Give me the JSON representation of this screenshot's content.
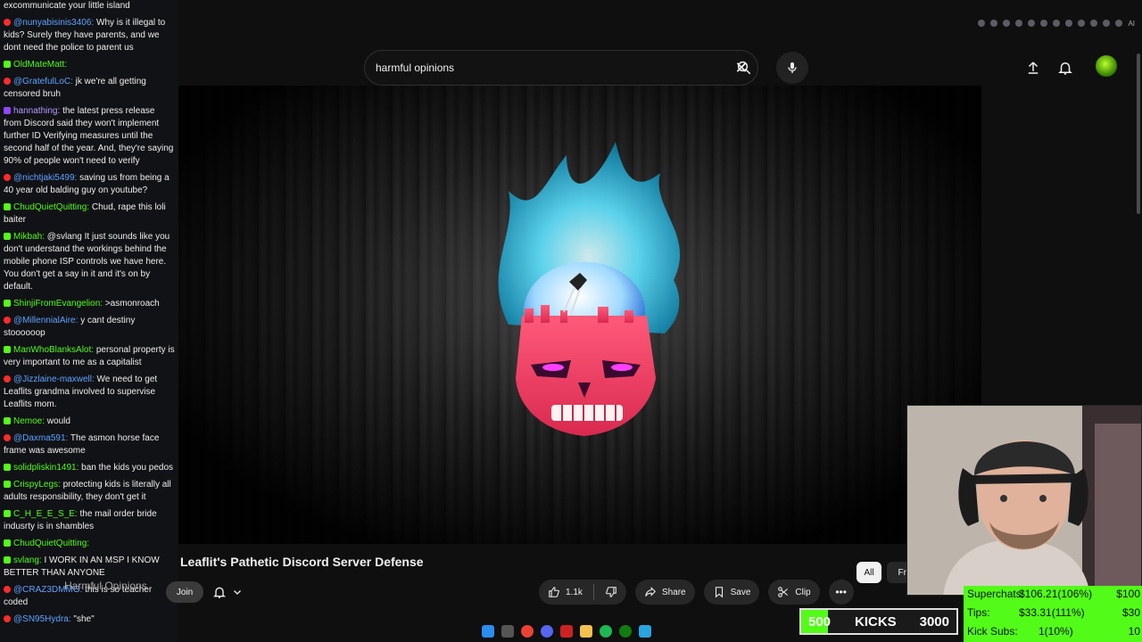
{
  "chat": {
    "messages": [
      {
        "platform": "none",
        "user": "",
        "text": "excommunicate your little island"
      },
      {
        "platform": "yt",
        "user": "@nunyabisinis3406:",
        "text": "Why is it illegal to kids? Surely they have parents, and we dont need the police to parent us"
      },
      {
        "platform": "kick",
        "user": "OldMateMatt:",
        "text": ""
      },
      {
        "platform": "yt",
        "user": "@GratefulLoC:",
        "text": "jk we're all getting censored bruh"
      },
      {
        "platform": "tw",
        "user": "hannathing:",
        "text": "the latest press release from Discord said they won't implement further ID Verifying measures until the second half of the year. And, they're saying 90% of people won't need to verify"
      },
      {
        "platform": "yt",
        "user": "@nichtjaki5499:",
        "text": "saving us from being a 40 year old balding guy on youtube?"
      },
      {
        "platform": "kick",
        "user": "ChudQuietQuitting:",
        "text": "Chud, rape this loli baiter"
      },
      {
        "platform": "kick",
        "user": "Mikbah:",
        "text": "@svlang It just sounds like you don't understand the workings behind the mobile phone ISP controls we have here. You don't get a say in it and it's on by default."
      },
      {
        "platform": "kick",
        "user": "ShinjiFromEvangelion:",
        "text": ">asmonroach"
      },
      {
        "platform": "yt",
        "user": "@MillennialAire:",
        "text": "y cant destiny stoooooop"
      },
      {
        "platform": "kick",
        "user": "ManWhoBlanksAlot:",
        "text": "personal property is very important to me as a capitalist"
      },
      {
        "platform": "yt",
        "user": "@Jizzlaine-maxwell:",
        "text": "We need to get Leaflits grandma involved to supervise Leaflits mom."
      },
      {
        "platform": "kick",
        "user": "Nemoe:",
        "text": "would"
      },
      {
        "platform": "yt",
        "user": "@Daxma591:",
        "text": "The asmon horse face frame was awesome"
      },
      {
        "platform": "kick",
        "user": "solidpliskin1491:",
        "text": "ban the kids you pedos"
      },
      {
        "platform": "kick",
        "user": "CrispyLegs:",
        "text": "protecting kids is literally all adults responsibility, they don't get it"
      },
      {
        "platform": "kick",
        "user": "C_H_E_E_S_E:",
        "text": "the mail order bride indusrty is in shambles"
      },
      {
        "platform": "kick",
        "user": "ChudQuietQuitting:",
        "text": ""
      },
      {
        "platform": "kick",
        "user": "svlang:",
        "text": "I WORK IN AN MSP I KNOW BETTER THAN ANYONE"
      },
      {
        "platform": "yt",
        "user": "@CRAZ3DMMG:",
        "text": "this is so teacher coded"
      },
      {
        "platform": "yt",
        "user": "@SN95Hydra:",
        "text": "\"she\""
      }
    ]
  },
  "search": {
    "query": "harmful opinions"
  },
  "icons": {
    "clear": "close-icon",
    "search": "search-icon",
    "mic": "mic-icon",
    "upload": "upload-icon",
    "bell": "bell-icon"
  },
  "browser": {
    "ai_label": "AI"
  },
  "video": {
    "title": "Leaflit's Pathetic Discord Server Defense",
    "channel": "Harmful Opinions",
    "join_label": "Join",
    "likes": "1.1k",
    "share_label": "Share",
    "save_label": "Save",
    "clip_label": "Clip",
    "more_label": "•••"
  },
  "chips": {
    "all": "All",
    "next": "Fr"
  },
  "goal": {
    "start": "500",
    "label": "KICKS",
    "end": "3000",
    "progress": 0.17
  },
  "stats": {
    "superchats": {
      "label": "Superchats:",
      "value": "$106.21(106%)",
      "target": "$100"
    },
    "tips": {
      "label": "Tips:",
      "value": "$33.31(111%)",
      "target": "$30"
    },
    "kicksubs": {
      "label": "Kick Subs:",
      "value": "1(10%)",
      "target": "10"
    }
  },
  "colors": {
    "kick_green": "#53fc18",
    "yt_red": "#ff2b2b",
    "twitch_purple": "#9146ff"
  }
}
